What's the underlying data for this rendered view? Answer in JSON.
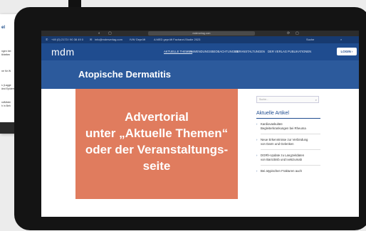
{
  "background_sheet": {
    "title": "el",
    "lines": [
      "ngen bei",
      "tkheiten",
      "ne für W",
      "s (Lagge",
      "änd Epidem",
      "ndMärkt",
      "h in Beh"
    ]
  },
  "browser": {
    "url": "mdmverlag.com"
  },
  "infobar": {
    "phone": "+49 (0) 2173 / 90 38 49 0",
    "email": "info@mdmverlag.com",
    "ivw": "IVW Geprüft",
    "study": "A MED geprüft Facharzt-Studie 2023",
    "search": "Suche"
  },
  "header": {
    "logo": "mdm",
    "nav": [
      "AKTUELLE THEMEN",
      "ANWENDUNGSBEOBACHTUNGEN",
      "VERANSTALTUNGEN",
      "DER VERLAG",
      "PUBLIKATIONEN"
    ],
    "login": "LOGIN"
  },
  "hero": {
    "title": "Atopische Dermatitis"
  },
  "advertorial": {
    "lines": [
      "Advertorial",
      "unter „Aktuelle Themen“",
      "oder der Veranstaltungs-",
      "seite"
    ]
  },
  "sidebar": {
    "search_placeholder": "Suche...",
    "title": "Aktuelle Artikel",
    "articles": [
      [
        "Kardiovaskuläre",
        "Begleiterkrankungen bei Rheuma"
      ],
      [
        "Neue Erkenntnisse zur Verbindung",
        "von Darm und Gelenken"
      ],
      [
        "DGRh-Update zu Langzeitdaten",
        "von Baricitinib und Ixekizumab"
      ],
      [
        "Bei atypischen Frakturen auch",
        ""
      ]
    ]
  }
}
